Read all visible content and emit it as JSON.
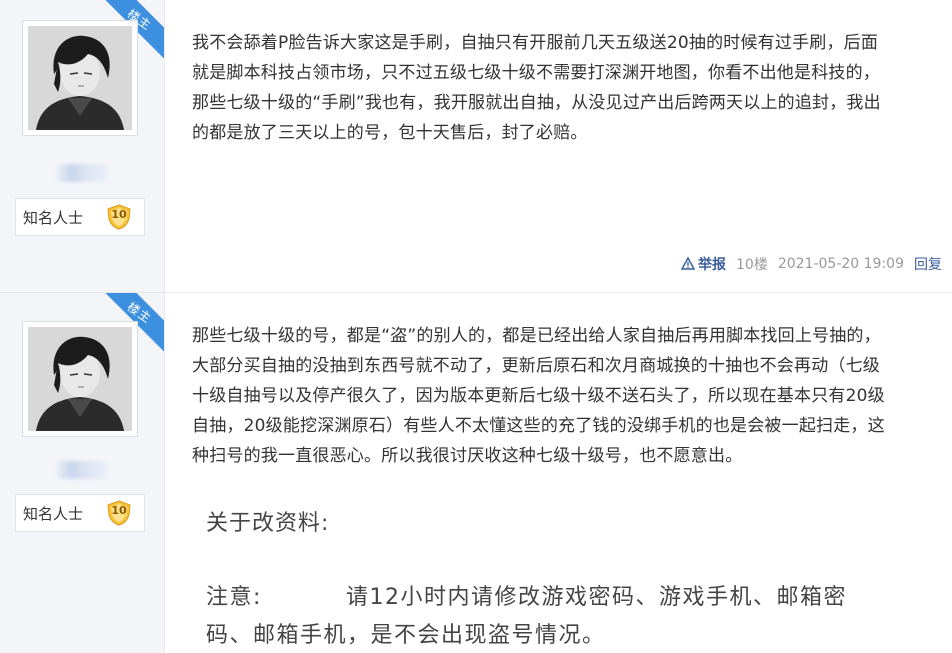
{
  "posts": [
    {
      "badge": "楼主",
      "user_title": "知名人士",
      "level": "10",
      "content": [
        "我不会舔着P脸告诉大家这是手刷，自抽只有开服前几天五级送20抽的时候有过手刷，后面",
        "就是脚本科技占领市场，只不过五级七级十级不需要打深渊开地图，你看不出他是科技的，",
        "那些七级十级的“手刷”我也有，我开服就出自抽，从没见过产出后跨两天以上的追封，我出",
        "的都是放了三天以上的号，包十天售后，封了必赔。"
      ],
      "meta": {
        "report": "举报",
        "floor": "10楼",
        "time": "2021-05-20 19:09",
        "reply": "回复"
      }
    },
    {
      "badge": "楼主",
      "user_title": "知名人士",
      "level": "10",
      "content": [
        "那些七级十级的号，都是“盗”的别人的，都是已经出给人家自抽后再用脚本找回上号抽的，",
        "大部分买自抽的没抽到东西号就不动了，更新后原石和次月商城换的十抽也不会再动（七级",
        "十级自抽号以及停产很久了，因为版本更新后七级十级不送石头了，所以现在基本只有20级",
        "自抽，20级能挖深渊原石）有些人不太懂这些的充了钱的没绑手机的也是会被一起扫走，这",
        "种扫号的我一直很恶心。所以我很讨厌收这种七级十级号，也不愿意出。"
      ],
      "embedded": {
        "heading": "关于改资料:",
        "note_label": "注意:",
        "note_line1": "请12小时内请修改游戏密码、游戏手机、邮箱密",
        "note_line2": "码、邮箱手机，是不会出现盗号情况。"
      }
    }
  ]
}
